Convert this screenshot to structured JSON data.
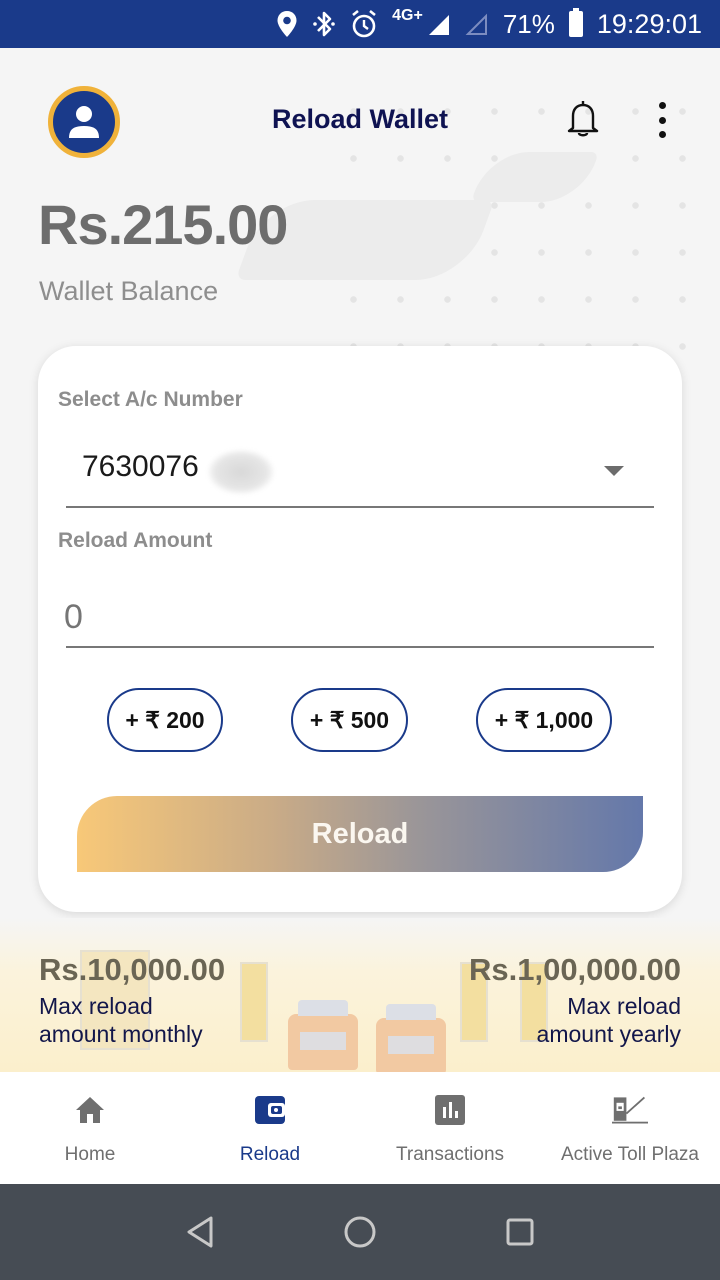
{
  "status_bar": {
    "network_label": "4G+",
    "battery_percent": "71%",
    "time": "19:29:01",
    "icons": [
      "location-icon",
      "bluetooth-icon",
      "alarm-icon",
      "signal-icon",
      "signal-empty-icon",
      "battery-icon"
    ]
  },
  "header": {
    "title": "Reload Wallet",
    "avatar_icon": "user-avatar-icon",
    "notification_icon": "bell-icon",
    "menu_icon": "more-vertical-icon"
  },
  "wallet": {
    "balance": "Rs.215.00",
    "balance_label": "Wallet Balance"
  },
  "form": {
    "account_label": "Select A/c Number",
    "account_value": "7630076",
    "amount_label": "Reload Amount",
    "amount_value": "",
    "amount_placeholder": "0",
    "quick_amounts": [
      "+ ₹ 200",
      "+ ₹ 500",
      "+ ₹ 1,000"
    ],
    "reload_button": "Reload"
  },
  "limits": {
    "monthly_amount": "Rs.10,000.00",
    "monthly_label_line1": "Max reload",
    "monthly_label_line2": "amount monthly",
    "yearly_amount": "Rs.1,00,000.00",
    "yearly_label_line1": "Max reload",
    "yearly_label_line2": "amount yearly"
  },
  "bottom_nav": {
    "active": "Reload",
    "items": [
      {
        "label": "Home",
        "icon": "home-icon"
      },
      {
        "label": "Reload",
        "icon": "wallet-icon"
      },
      {
        "label": "Transactions",
        "icon": "bar-chart-icon"
      },
      {
        "label": "Active Toll Plaza",
        "icon": "toll-booth-icon"
      }
    ]
  },
  "colors": {
    "primary": "#1a3a8a",
    "accent": "#f0b23a",
    "title_text": "#0f1352",
    "gradient_start": "#f8c878",
    "gradient_end": "#6478aa"
  }
}
